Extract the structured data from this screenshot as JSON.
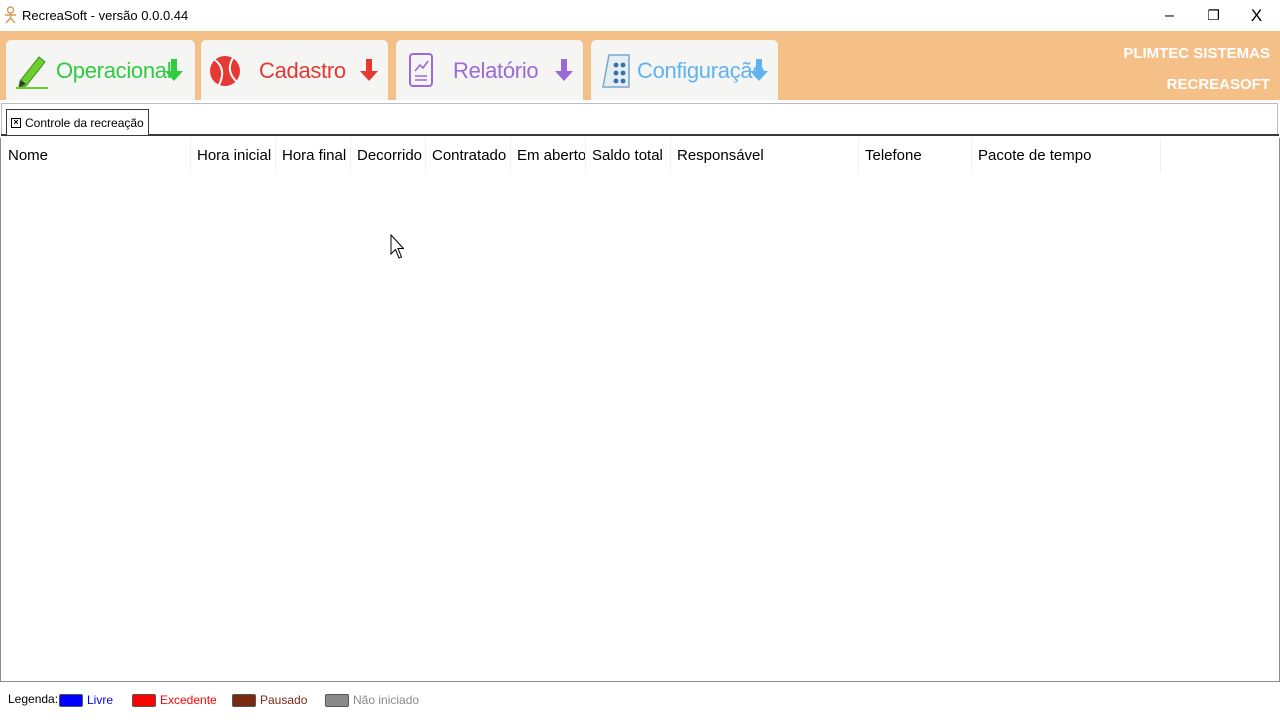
{
  "window": {
    "app_name": "RecreaSoft",
    "version_label": "versão 0.0.0.44",
    "minimize_symbol": "–",
    "restore_symbol": "❐",
    "close_symbol": "X"
  },
  "ribbon": {
    "background": "#f5bf88",
    "menus": [
      {
        "label": "Operacional",
        "color": "#2ecc40",
        "icon": "pencil-icon",
        "arrow_color": "#2ecc40"
      },
      {
        "label": "Cadastro",
        "color": "#e53935",
        "icon": "ball-icon",
        "arrow_color": "#e53935"
      },
      {
        "label": "Relatório",
        "color": "#9c6ad6",
        "icon": "report-icon",
        "arrow_color": "#9c6ad6"
      },
      {
        "label": "Configuração",
        "color": "#5fb3f0",
        "icon": "config-icon",
        "arrow_color": "#5fb3f0"
      }
    ],
    "brand_line1": "PLIMTEC SISTEMAS",
    "brand_line2": "RECREASOFT"
  },
  "doc_tabs": [
    {
      "label": "Controle da recreação",
      "close_symbol": "×"
    }
  ],
  "grid": {
    "columns": [
      "Nome",
      "Hora inicial",
      "Hora final",
      "Decorrido",
      "Contratado",
      "Em aberto",
      "Saldo total",
      "Responsável",
      "Telefone",
      "Pacote de tempo"
    ],
    "rows": []
  },
  "legend": {
    "title": "Legenda:",
    "items": [
      {
        "label": "Livre",
        "color": "#0000ff",
        "text_color": "#0000ff"
      },
      {
        "label": "Excedente",
        "color": "#ff0000",
        "text_color": "#ff0000"
      },
      {
        "label": "Pausado",
        "color": "#7a2a10",
        "text_color": "#7a2a10"
      },
      {
        "label": "Não iniciado",
        "color": "#8a8a8a",
        "text_color": "#8a8a8a"
      }
    ]
  }
}
